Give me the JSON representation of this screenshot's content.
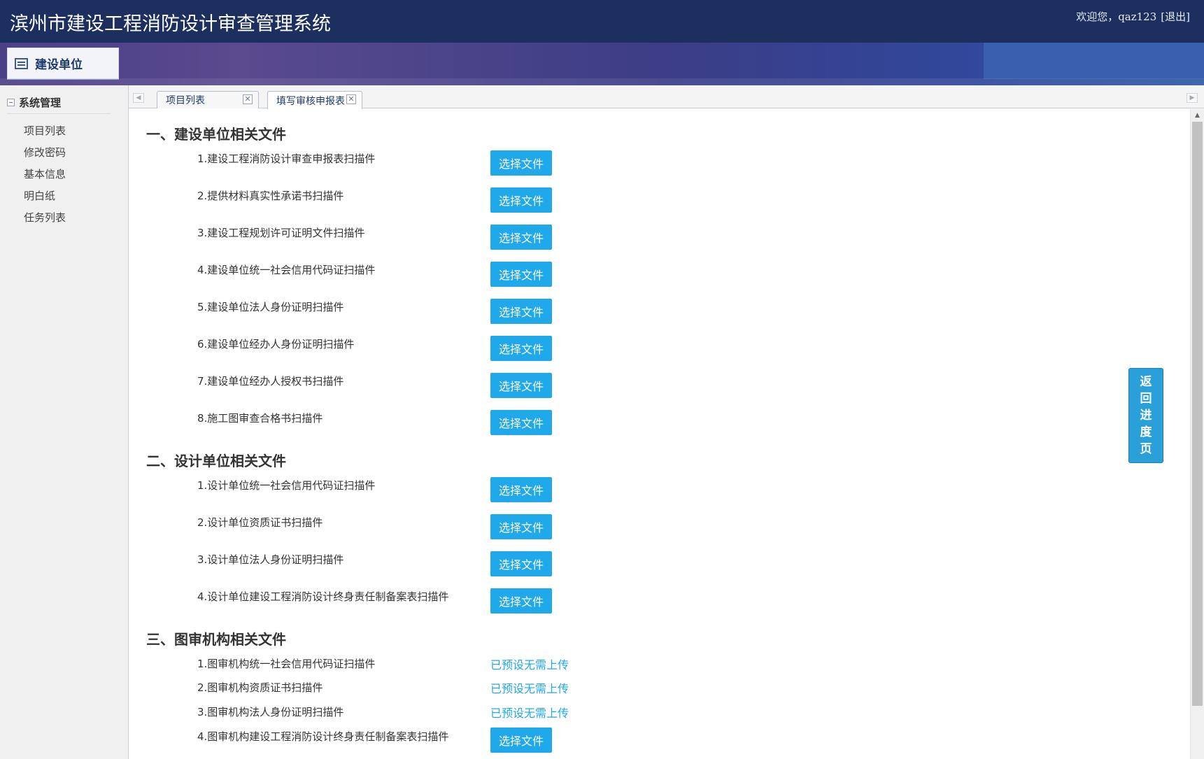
{
  "header": {
    "title": "滨州市建设工程消防设计审查管理系统",
    "welcome": "欢迎您，qaz123",
    "logout": "[退出]"
  },
  "module": {
    "label": "建设单位"
  },
  "sidebar": {
    "group_label": "系统管理",
    "items": [
      {
        "label": "项目列表"
      },
      {
        "label": "修改密码"
      },
      {
        "label": "基本信息"
      },
      {
        "label": "明白纸"
      },
      {
        "label": "任务列表"
      }
    ]
  },
  "tabs": [
    {
      "label": "项目列表",
      "active": false
    },
    {
      "label": "填写审核申报表",
      "active": true
    }
  ],
  "icons": {
    "tab_close": "close-icon",
    "scroll_left": "chevron-left-icon",
    "scroll_right": "chevron-right-icon",
    "module": "list-icon",
    "collapse": "minus-icon"
  },
  "colors": {
    "header": "#1d2f5f",
    "primary_button": "#1fa8ea",
    "preset_text": "#1fa8ea",
    "back_button": "#2aa0db"
  },
  "main": {
    "button_label": "选择文件",
    "preset_label": "已预设无需上传",
    "sections": [
      {
        "title": "一、建设单位相关文件",
        "items": [
          {
            "label": "1.建设工程消防设计审查申报表扫描件",
            "action": "button"
          },
          {
            "label": "2.提供材料真实性承诺书扫描件",
            "action": "button"
          },
          {
            "label": "3.建设工程规划许可证明文件扫描件",
            "action": "button"
          },
          {
            "label": "4.建设单位统一社会信用代码证扫描件",
            "action": "button"
          },
          {
            "label": "5.建设单位法人身份证明扫描件",
            "action": "button"
          },
          {
            "label": "6.建设单位经办人身份证明扫描件",
            "action": "button"
          },
          {
            "label": "7.建设单位经办人授权书扫描件",
            "action": "button"
          },
          {
            "label": "8.施工图审查合格书扫描件",
            "action": "button"
          }
        ]
      },
      {
        "title": "二、设计单位相关文件",
        "items": [
          {
            "label": "1.设计单位统一社会信用代码证扫描件",
            "action": "button"
          },
          {
            "label": "2.设计单位资质证书扫描件",
            "action": "button"
          },
          {
            "label": "3.设计单位法人身份证明扫描件",
            "action": "button"
          },
          {
            "label": "4.设计单位建设工程消防设计终身责任制备案表扫描件",
            "action": "button"
          }
        ]
      },
      {
        "title": "三、图审机构相关文件",
        "items": [
          {
            "label": "1.图审机构统一社会信用代码证扫描件",
            "action": "preset"
          },
          {
            "label": "2.图审机构资质证书扫描件",
            "action": "preset"
          },
          {
            "label": "3.图审机构法人身份证明扫描件",
            "action": "preset"
          },
          {
            "label": "4.图审机构建设工程消防设计终身责任制备案表扫描件",
            "action": "button"
          }
        ]
      }
    ]
  },
  "back_button": {
    "label": "返回进度页"
  }
}
